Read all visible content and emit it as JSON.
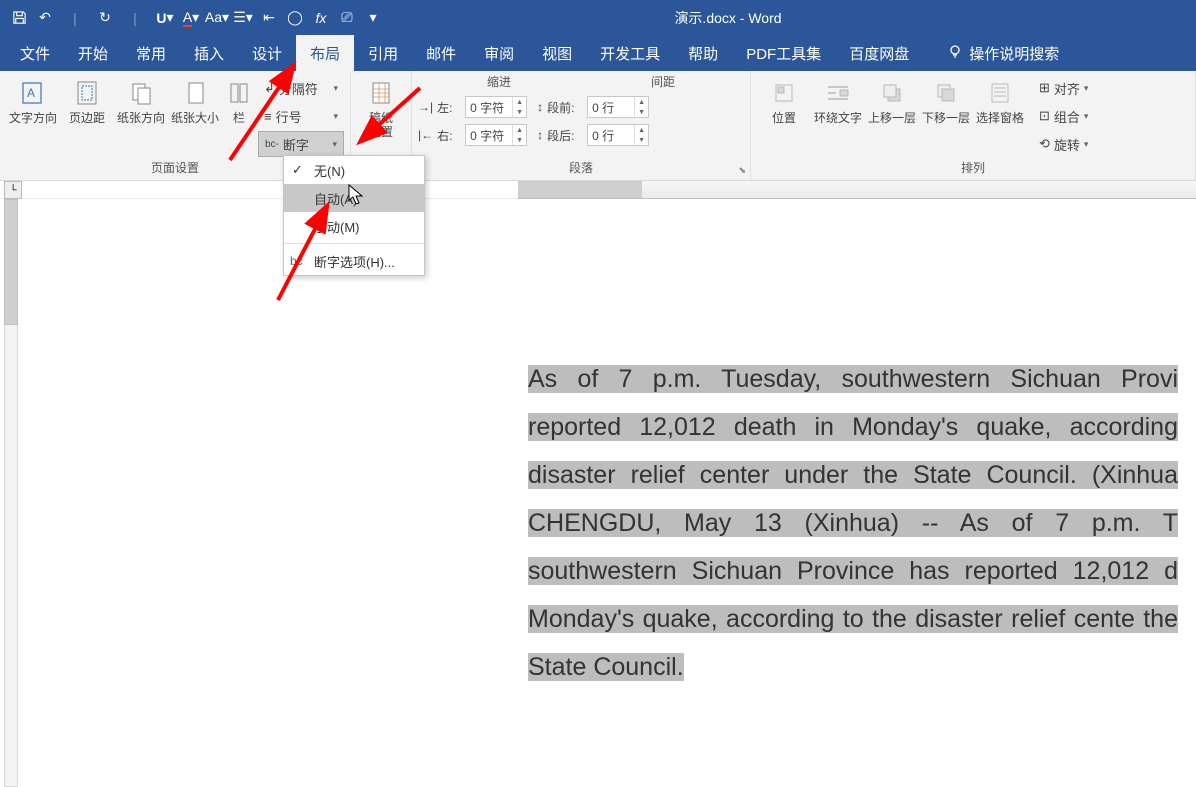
{
  "app": {
    "title": "演示.docx - Word"
  },
  "paragraph_group": {
    "indent_title": "缩进",
    "spacing_title": "间距"
  },
  "tabs": {
    "file": "文件",
    "home": "开始",
    "common": "常用",
    "insert": "插入",
    "design": "设计",
    "layout": "布局",
    "references": "引用",
    "mail": "邮件",
    "review": "审阅",
    "view": "视图",
    "dev": "开发工具",
    "help": "帮助",
    "pdf": "PDF工具集",
    "baidu": "百度网盘",
    "search": "操作说明搜索"
  },
  "groups": {
    "page_setup": "页面设置",
    "paragraph": "段落",
    "arrange": "排列"
  },
  "btns": {
    "text_direction": "文字方向",
    "margins": "页边距",
    "orientation": "纸张方向",
    "size": "纸张大小",
    "columns": "栏",
    "breaks": "分隔符",
    "line_numbers": "行号",
    "hyphenation": "断字",
    "manuscript": "稿纸\n设置",
    "left": "左:",
    "right": "右:",
    "before": "段前:",
    "after": "段后:",
    "position": "位置",
    "wrap": "环绕文字",
    "forward": "上移一层",
    "backward": "下移一层",
    "selection": "选择窗格",
    "align": "对齐",
    "group": "组合",
    "rotate": "旋转"
  },
  "spin": {
    "left": "0 字符",
    "right": "0 字符",
    "before": "0 行",
    "after": "0 行"
  },
  "menu": {
    "none": "无(N)",
    "auto": "自动(A)",
    "manual": "手动(M)",
    "options": "断字选项(H)..."
  },
  "chart_data": null,
  "document": {
    "text": "As of 7 p.m. Tuesday, southwestern Sichuan Provi reported 12,012 death in Monday's quake, according disaster relief center under the State Council. (Xinhua CHENGDU, May 13 (Xinhua) -- As of 7 p.m. T southwestern Sichuan Province has reported 12,012 d Monday's quake, according to the disaster relief cente the State Council."
  }
}
